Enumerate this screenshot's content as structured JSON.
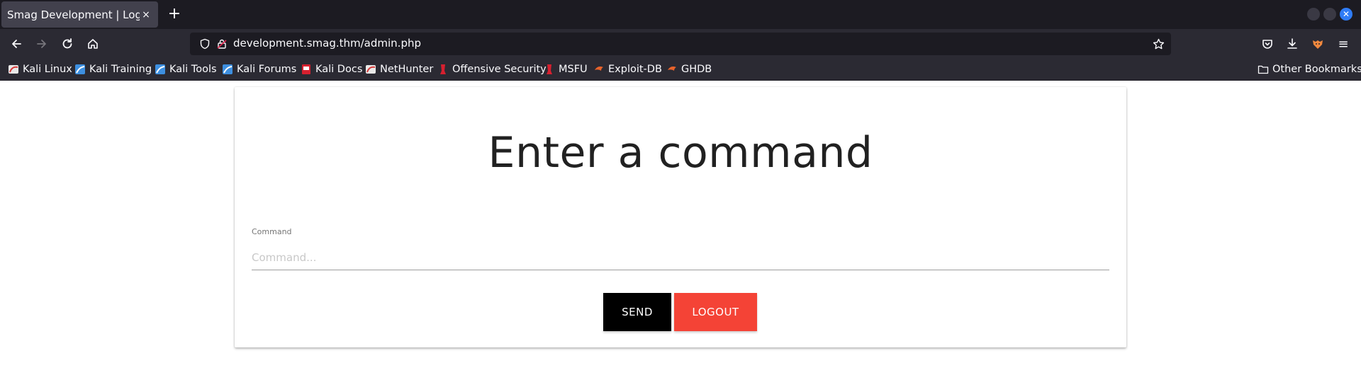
{
  "browser": {
    "tab_title": "Smag Development | Login",
    "tab_close": "×",
    "new_tab": "+",
    "url": "development.smag.thm/admin.php",
    "menu_icon": "≡"
  },
  "bookmarks": [
    {
      "label": "Kali Linux",
      "icon": "kali-dragon-icon"
    },
    {
      "label": "Kali Training",
      "icon": "kali-training-icon"
    },
    {
      "label": "Kali Tools",
      "icon": "kali-tools-icon"
    },
    {
      "label": "Kali Forums",
      "icon": "kali-forums-icon"
    },
    {
      "label": "Kali Docs",
      "icon": "kali-docs-icon"
    },
    {
      "label": "NetHunter",
      "icon": "nethunter-icon"
    },
    {
      "label": "Offensive Security",
      "icon": "offsec-icon"
    },
    {
      "label": "MSFU",
      "icon": "msfu-icon"
    },
    {
      "label": "Exploit-DB",
      "icon": "exploit-db-icon"
    },
    {
      "label": "GHDB",
      "icon": "ghdb-icon"
    }
  ],
  "other_bookmarks": "Other Bookmarks",
  "page": {
    "heading": "Enter a command",
    "field_label": "Command",
    "field_placeholder": "Command...",
    "field_value": "",
    "send_label": "SEND",
    "logout_label": "LOGOUT"
  },
  "colors": {
    "tab_strip": "#1c1b22",
    "toolbar": "#2b2a33",
    "send_button": "#000000",
    "logout_button": "#f44336"
  }
}
